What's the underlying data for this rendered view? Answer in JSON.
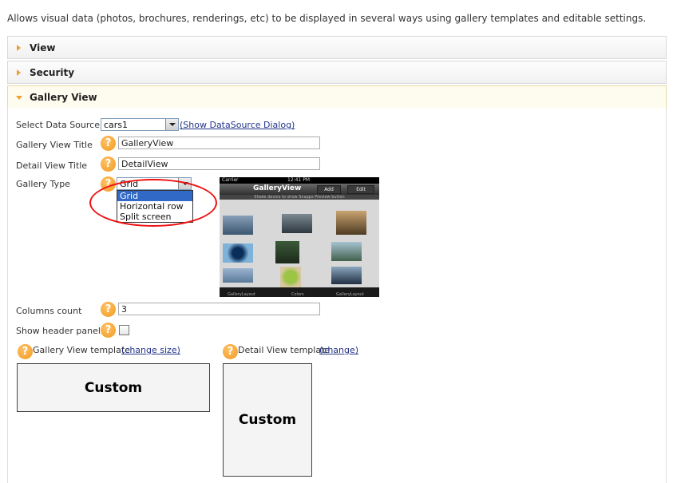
{
  "description": "Allows visual data (photos, brochures, renderings, etc) to be displayed in several ways using gallery templates and editable settings.",
  "sections": [
    {
      "label": "View",
      "expanded": false
    },
    {
      "label": "Security",
      "expanded": false
    },
    {
      "label": "Gallery View",
      "expanded": true
    }
  ],
  "form": {
    "data_source_label": "Select Data Source:",
    "data_source_value": "cars1",
    "show_datasource_link": "(Show DataSource Dialog)",
    "gallery_title_label": "Gallery View Title",
    "gallery_title_value": "GalleryView",
    "detail_title_label": "Detail View Title",
    "detail_title_value": "DetailView",
    "gallery_type_label": "Gallery Type",
    "gallery_type_value": "Grid",
    "gallery_type_options": [
      "Grid",
      "Horizontal row",
      "Split screen"
    ],
    "columns_label": "Columns count",
    "columns_value": "3",
    "show_header_label": "Show header panel",
    "show_header_checked": false,
    "gallery_template_label": "Gallery View template",
    "gallery_template_link": "(change size)",
    "gallery_template_value": "Custom",
    "detail_template_label": "Detail View template",
    "detail_template_link": "(change)",
    "detail_template_value": "Custom"
  },
  "help_glyph": "?",
  "preview": {
    "carrier": "Carrier",
    "time": "12:41 PM",
    "title": "GalleryView",
    "add": "Add",
    "edit": "Edit",
    "hint": "Shake device to show Snapps Preview button",
    "tabs": [
      "GalleryLayout",
      "Colors",
      "GalleryLayout"
    ]
  },
  "colors": {
    "accent": "#f29a1e",
    "link": "#22338a",
    "highlight": "#e11111",
    "selected": "#3169c6"
  }
}
